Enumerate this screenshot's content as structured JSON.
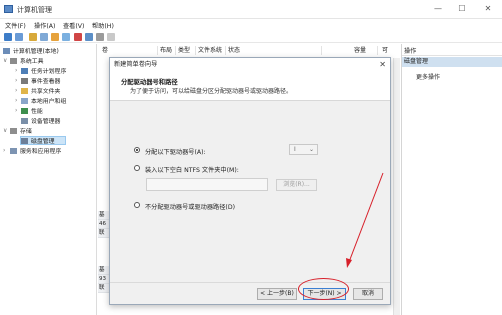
{
  "window": {
    "title": "计算机管理"
  },
  "menu": [
    "文件(F)",
    "操作(A)",
    "查看(V)",
    "帮助(H)"
  ],
  "tree": {
    "root": "计算机管理(本地)",
    "system_tools": "系统工具",
    "task_scheduler": "任务计划程序",
    "event_viewer": "事件查看器",
    "shared_folders": "共享文件夹",
    "local_users": "本地用户和组",
    "performance": "性能",
    "device_manager": "设备管理器",
    "storage": "存储",
    "disk_management": "磁盘管理",
    "services_apps": "服务和应用程序"
  },
  "center": {
    "columns": [
      "卷",
      "布局",
      "类型",
      "文件系统",
      "状态",
      "容量",
      "可"
    ],
    "disk_a": [
      "基",
      "46",
      "联"
    ],
    "disk_b": [
      "基",
      "93",
      "联"
    ]
  },
  "actions": {
    "header": "操作",
    "section": "磁盘管理",
    "more": "更多操作"
  },
  "dialog": {
    "title": "新建简单卷向导",
    "heading": "分配驱动器号和路径",
    "description": "为了便于访问，可以给磁盘分区分配驱动器号或驱动器路径。",
    "option1": "分配以下驱动器号(A):",
    "drive_letter": "I",
    "option2": "装入以下空白 NTFS 文件夹中(M):",
    "browse": "浏览(R)...",
    "option3": "不分配驱动器号或驱动器路径(D)",
    "back": "< 上一步(B)",
    "next": "下一步(N) >",
    "cancel": "取消"
  },
  "colors": {
    "annotation": "#d7202a",
    "selection": "#cce4f7"
  }
}
